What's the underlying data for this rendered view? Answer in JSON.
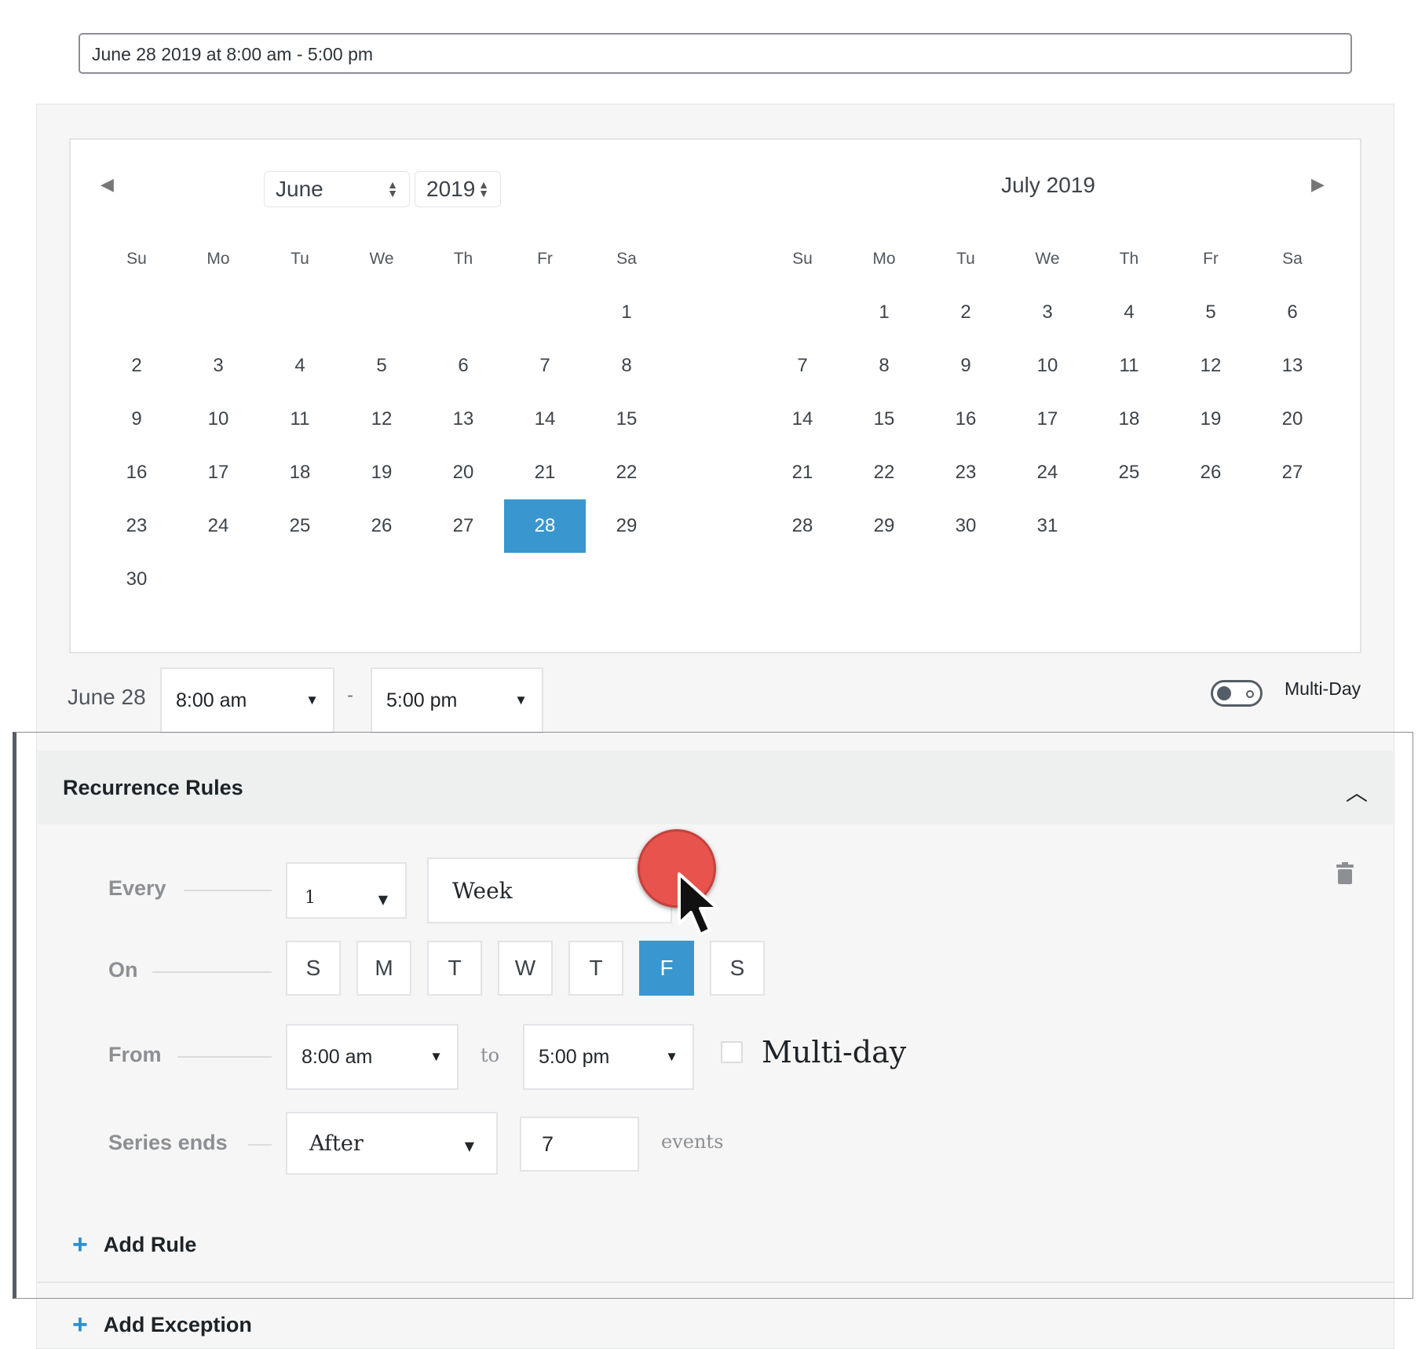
{
  "summary": "June 28 2019 at 8:00 am - 5:00 pm",
  "calendar": {
    "prev_icon": "triangle-left-icon",
    "next_icon": "triangle-right-icon",
    "month_select": "June",
    "year_select": "2019",
    "second_month_title": "July 2019",
    "weekdays": [
      "Su",
      "Mo",
      "Tu",
      "We",
      "Th",
      "Fr",
      "Sa"
    ],
    "june_days": [
      "",
      "",
      "",
      "",
      "",
      "",
      "1",
      "2",
      "3",
      "4",
      "5",
      "6",
      "7",
      "8",
      "9",
      "10",
      "11",
      "12",
      "13",
      "14",
      "15",
      "16",
      "17",
      "18",
      "19",
      "20",
      "21",
      "22",
      "23",
      "24",
      "25",
      "26",
      "27",
      "28",
      "29",
      "30"
    ],
    "july_days": [
      "",
      "1",
      "2",
      "3",
      "4",
      "5",
      "6",
      "7",
      "8",
      "9",
      "10",
      "11",
      "12",
      "13",
      "14",
      "15",
      "16",
      "17",
      "18",
      "19",
      "20",
      "21",
      "22",
      "23",
      "24",
      "25",
      "26",
      "27",
      "28",
      "29",
      "30",
      "31"
    ],
    "selected_day": "28",
    "accent_color": "#3a96cf"
  },
  "event_time": {
    "date_label": "June 28",
    "start": "8:00 am",
    "separator": "-",
    "end": "5:00 pm",
    "multiday_toggle_label": "Multi-Day"
  },
  "recurrence": {
    "title": "Recurrence Rules",
    "every_label": "Every",
    "every_count": "1",
    "every_unit": "Week",
    "on_label": "On",
    "days": [
      "S",
      "M",
      "T",
      "W",
      "T",
      "F",
      "S"
    ],
    "active_day_index": 5,
    "from_label": "From",
    "from_start": "8:00 am",
    "to_label": "to",
    "from_end": "5:00 pm",
    "multiday_label": "Multi-day",
    "series_ends_label": "Series ends",
    "series_ends_value": "After",
    "series_ends_count": "7",
    "events_label": "events",
    "add_rule": "Add Rule",
    "add_exception": "Add Exception"
  }
}
